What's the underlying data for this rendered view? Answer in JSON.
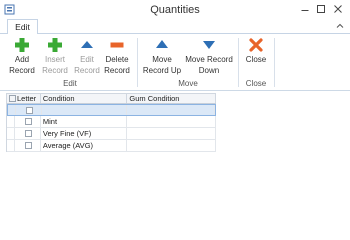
{
  "window": {
    "title": "Quantities"
  },
  "tabs": [
    {
      "label": "Edit"
    }
  ],
  "ribbon": {
    "buttons": [
      {
        "line1": "Add",
        "line2": "Record",
        "enabled": true
      },
      {
        "line1": "Insert",
        "line2": "Record",
        "enabled": false
      },
      {
        "line1": "Edit",
        "line2": "Record",
        "enabled": false
      },
      {
        "line1": "Delete",
        "line2": "Record",
        "enabled": true
      },
      {
        "line1": "Move",
        "line2": "Record Up",
        "enabled": true
      },
      {
        "line1": "Move Record",
        "line2": "Down",
        "enabled": true
      },
      {
        "line1": "Close",
        "line2": "",
        "enabled": true
      }
    ],
    "groups": [
      {
        "label": "Edit"
      },
      {
        "label": "Move"
      },
      {
        "label": "Close"
      }
    ]
  },
  "grid": {
    "columns": [
      {
        "label": "Letter"
      },
      {
        "label": "Condition"
      },
      {
        "label": "Gum Condition"
      }
    ],
    "rows": [
      {
        "condition": "",
        "gum": ""
      },
      {
        "condition": "Mint",
        "gum": ""
      },
      {
        "condition": "Very Fine (VF)",
        "gum": ""
      },
      {
        "condition": "Average (AVG)",
        "gum": ""
      }
    ]
  },
  "colors": {
    "add": "#3aa935",
    "move": "#2e6fb5",
    "delete": "#e8642a",
    "close": "#e8642a",
    "selection": "#dbe8f7"
  },
  "icons": {
    "app": "app-icon",
    "add": "plus-icon",
    "insert": "plus-icon",
    "edit": "triangle-up-icon",
    "delete": "minus-icon",
    "move_up": "triangle-up-icon",
    "move_down": "triangle-down-icon",
    "close": "x-icon"
  }
}
